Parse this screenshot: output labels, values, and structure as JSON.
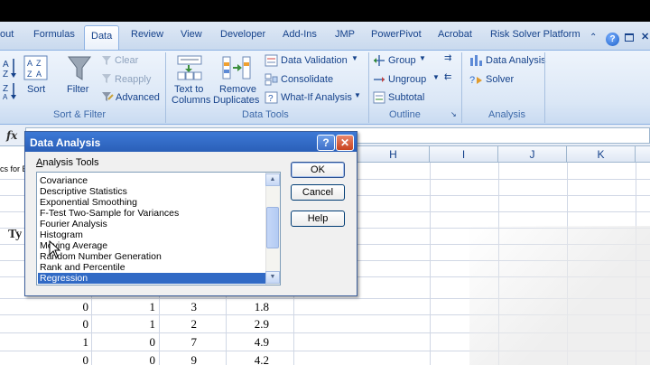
{
  "ribbon_tabs": [
    "out",
    "Formulas",
    "Data",
    "Review",
    "View",
    "Developer",
    "Add-Ins",
    "JMP",
    "PowerPivot",
    "Acrobat",
    "Risk Solver Platform"
  ],
  "ribbon": {
    "sort_label": "Sort",
    "filter_label": "Filter",
    "clear_label": "Clear",
    "reapply_label": "Reapply",
    "advanced_label": "Advanced",
    "sort_filter_group": "Sort & Filter",
    "text_to_columns_1": "Text to",
    "text_to_columns_2": "Columns",
    "remove_duplicates_1": "Remove",
    "remove_duplicates_2": "Duplicates",
    "data_validation_label": "Data Validation",
    "consolidate_label": "Consolidate",
    "what_if_label": "What-If Analysis",
    "data_tools_group": "Data Tools",
    "group_label": "Group",
    "ungroup_label": "Ungroup",
    "subtotal_label": "Subtotal",
    "outline_group": "Outline",
    "data_analysis_label": "Data Analysis",
    "solver_label": "Solver",
    "analysis_group": "Analysis"
  },
  "formula_bar": {
    "fx": "fx"
  },
  "sheet": {
    "columns": [
      "H",
      "I",
      "J",
      "K"
    ],
    "left_fragment": "cs for E",
    "left_text": "Ty",
    "rows": [
      [
        "0",
        "1",
        "3",
        "1.8"
      ],
      [
        "0",
        "1",
        "2",
        "2.9"
      ],
      [
        "1",
        "0",
        "7",
        "4.9"
      ],
      [
        "0",
        "0",
        "9",
        "4.2"
      ]
    ]
  },
  "dialog": {
    "title": "Data Analysis",
    "tools_label_first": "A",
    "tools_label_rest": "nalysis Tools",
    "items": [
      "Covariance",
      "Descriptive Statistics",
      "Exponential Smoothing",
      "F-Test Two-Sample for Variances",
      "Fourier Analysis",
      "Histogram",
      "Moving Average",
      "Random Number Generation",
      "Rank and Percentile",
      "Regression"
    ],
    "selected_index": 9,
    "ok_label": "OK",
    "cancel_label": "Cancel",
    "help_label": "Help",
    "help_title_glyph": "?",
    "close_title_glyph": "✕"
  },
  "colors": {
    "ribbon_text": "#15428b",
    "selection": "#316ac5",
    "titlebar": "#2a5fb8"
  }
}
